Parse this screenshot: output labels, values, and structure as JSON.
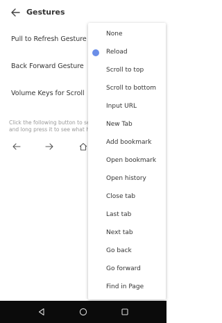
{
  "header": {
    "title": "Gestures"
  },
  "settings": [
    {
      "label": "Pull to Refresh Gesture"
    },
    {
      "label": "Back Forward Gesture"
    },
    {
      "label": "Volume Keys for Scroll"
    }
  ],
  "hint": {
    "line1": "Click the following button to set",
    "line2": "and long press it to see what ha"
  },
  "nav_icons": [
    "arrow-left-icon",
    "arrow-right-icon",
    "home-icon"
  ],
  "menu": {
    "selected_index": 1,
    "items": [
      {
        "label": "None"
      },
      {
        "label": "Reload"
      },
      {
        "label": "Scroll to top"
      },
      {
        "label": "Scroll to bottom"
      },
      {
        "label": "Input URL"
      },
      {
        "label": "New Tab"
      },
      {
        "label": "Add bookmark"
      },
      {
        "label": "Open bookmark"
      },
      {
        "label": "Open history"
      },
      {
        "label": "Close tab"
      },
      {
        "label": "Last tab"
      },
      {
        "label": "Next tab"
      },
      {
        "label": "Go back"
      },
      {
        "label": "Go forward"
      },
      {
        "label": "Find in Page"
      }
    ]
  },
  "system_nav": [
    "back-triangle-icon",
    "home-circle-icon",
    "recents-square-icon"
  ],
  "colors": {
    "accent": "#6b8ee8",
    "text": "#333333",
    "hint": "#999999",
    "system_bar": "#0b0b0b"
  }
}
